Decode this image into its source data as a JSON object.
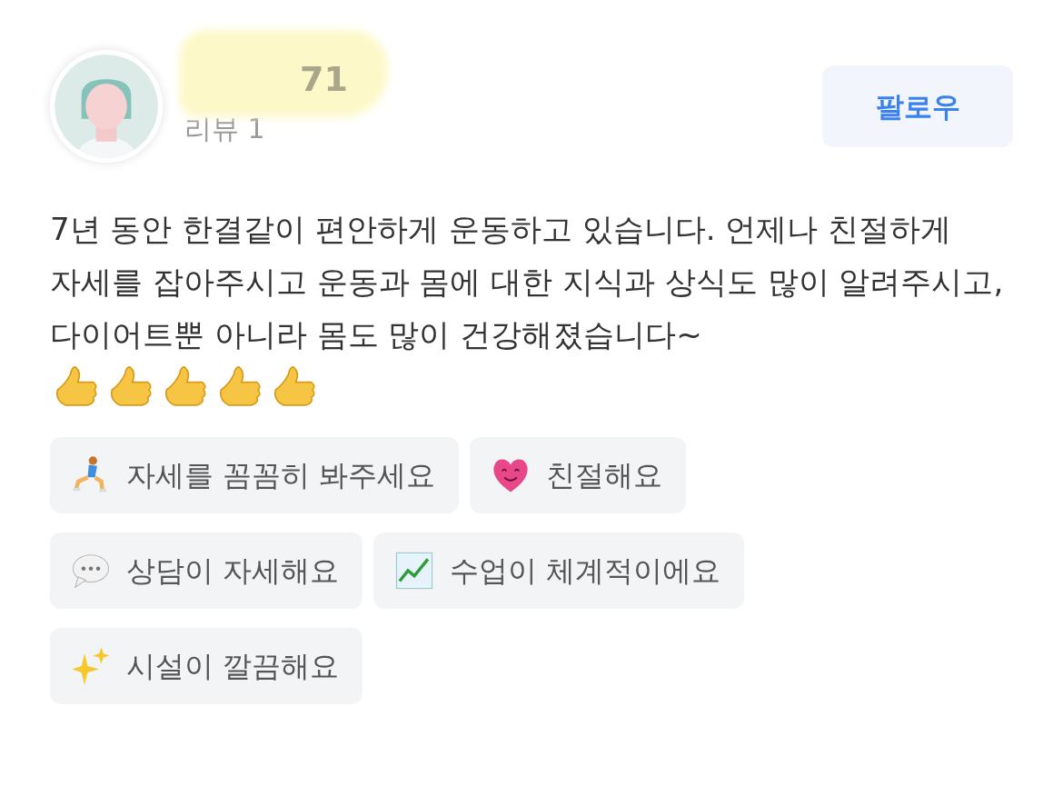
{
  "reviewer": {
    "name": "71",
    "name_redacted": true,
    "review_count": "리뷰 1"
  },
  "follow_button": {
    "label": "팔로우"
  },
  "review": {
    "text": "7년 동안 한결같이 편안하게 운동하고 있습니다. 언제나 친절하게 자세를 잡아주시고 운동과 몸에 대한 지식과 상식도 많이 알려주시고, 다이어트뿐 아니라 몸도 많이 건강해졌습니다~",
    "emojis": [
      {
        "kind": "thumbs-up"
      },
      {
        "kind": "thumbs-up"
      },
      {
        "kind": "thumbs-up"
      },
      {
        "kind": "thumbs-up"
      },
      {
        "kind": "thumbs-up"
      }
    ]
  },
  "tags": [
    {
      "kind": "runner",
      "label": "자세를 꼼꼼히 봐주세요"
    },
    {
      "kind": "heart",
      "label": "친절해요"
    },
    {
      "kind": "speech",
      "label": "상담이 자세해요"
    },
    {
      "kind": "chart",
      "label": "수업이 체계적이에요"
    },
    {
      "kind": "sparkles",
      "label": "시설이 깔끔해요"
    }
  ]
}
